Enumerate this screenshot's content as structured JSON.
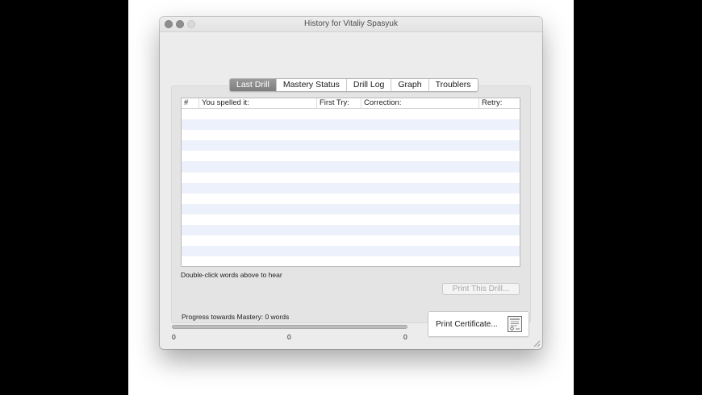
{
  "window": {
    "title": "History for Vitaliy Spasyuk"
  },
  "tabs": [
    {
      "label": "Last Drill",
      "active": true
    },
    {
      "label": "Mastery Status",
      "active": false
    },
    {
      "label": "Drill Log",
      "active": false
    },
    {
      "label": "Graph",
      "active": false
    },
    {
      "label": "Troublers",
      "active": false
    }
  ],
  "table": {
    "columns": [
      "#",
      "You spelled it:",
      "First Try:",
      "Correction:",
      "Retry:"
    ],
    "rows": []
  },
  "hint": "Double-click words above to hear",
  "print_drill_label": "Print This Drill...",
  "progress": {
    "label": "Progress towards Mastery:  0 words",
    "value": 0,
    "ticks": [
      "0",
      "0",
      "0"
    ]
  },
  "print_certificate_label": "Print Certificate...",
  "icons": {
    "certificate": "certificate-icon",
    "resize": "resize-grip-icon"
  },
  "colors": {
    "active_tab": "#8a8a8a",
    "stripe": "#edf1fb",
    "progress": "#5e8fd8"
  }
}
